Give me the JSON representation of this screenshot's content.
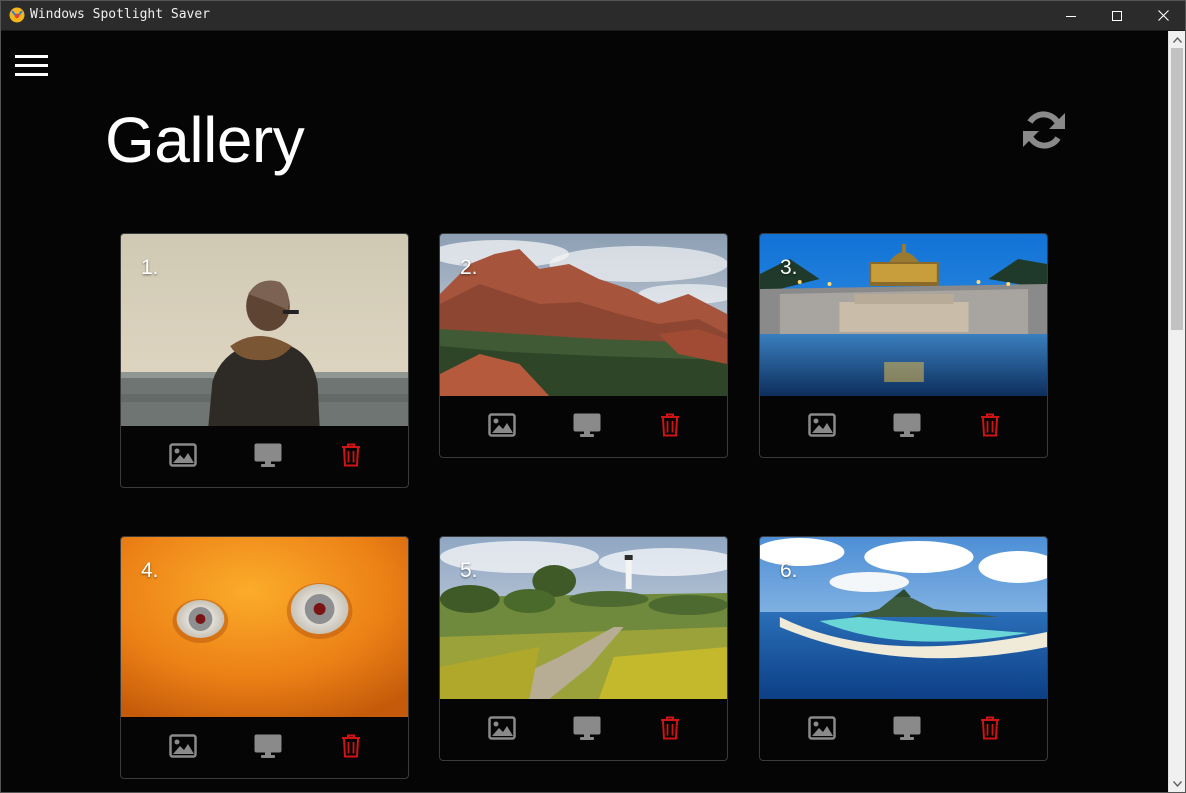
{
  "window": {
    "title": "Windows Spotlight Saver",
    "minimize_icon": "minimize-icon",
    "maximize_icon": "maximize-icon",
    "close_icon": "close-icon"
  },
  "header": {
    "menu_icon": "hamburger-menu-icon",
    "title": "Gallery",
    "refresh_icon": "refresh-icon"
  },
  "colors": {
    "background": "#050505",
    "titlebar": "#2b2b2b",
    "action_icon": "#8a8a8a",
    "delete_icon": "#d01414",
    "card_border": "#3a3a3a"
  },
  "gallery": {
    "items": [
      {
        "index": "1.",
        "scene": "person-by-sea",
        "actions": [
          "image-icon",
          "monitor-icon",
          "trash-icon"
        ]
      },
      {
        "index": "2.",
        "scene": "red-rock-mountains",
        "actions": [
          "image-icon",
          "monitor-icon",
          "trash-icon"
        ]
      },
      {
        "index": "3.",
        "scene": "palace-fountain-night",
        "actions": [
          "image-icon",
          "monitor-icon",
          "trash-icon"
        ]
      },
      {
        "index": "4.",
        "scene": "eyes-on-orange",
        "actions": [
          "image-icon",
          "monitor-icon",
          "trash-icon"
        ]
      },
      {
        "index": "5.",
        "scene": "lighthouse-meadow-path",
        "actions": [
          "image-icon",
          "monitor-icon",
          "trash-icon"
        ]
      },
      {
        "index": "6.",
        "scene": "tropical-island-aerial",
        "actions": [
          "image-icon",
          "monitor-icon",
          "trash-icon"
        ]
      }
    ]
  }
}
